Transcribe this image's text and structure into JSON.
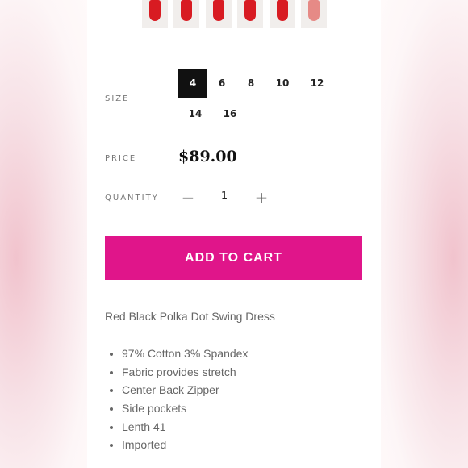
{
  "thumbnails": [
    {
      "icon": "dress-thumbnail",
      "tone": "red"
    },
    {
      "icon": "dress-thumbnail",
      "tone": "red"
    },
    {
      "icon": "dress-thumbnail",
      "tone": "red"
    },
    {
      "icon": "dress-thumbnail",
      "tone": "red"
    },
    {
      "icon": "dress-thumbnail",
      "tone": "red"
    },
    {
      "icon": "dress-thumbnail",
      "tone": "light-red"
    }
  ],
  "size": {
    "label": "SIZE",
    "options": [
      "4",
      "6",
      "8",
      "10",
      "12",
      "14",
      "16"
    ],
    "selected": "4"
  },
  "price": {
    "label": "PRICE",
    "value": "$89.00"
  },
  "quantity": {
    "label": "QUANTITY",
    "minus": "−",
    "value": "1",
    "plus": "+"
  },
  "cart": {
    "label": "ADD TO CART"
  },
  "description": {
    "title": "Red Black Polka Dot Swing Dress",
    "features": [
      "97% Cotton 3% Spandex",
      "Fabric provides stretch",
      "Center Back Zipper",
      "Side pockets",
      "Lenth 41",
      "Imported"
    ]
  },
  "colors": {
    "accent": "#e0158a",
    "selected_bg": "#111111"
  }
}
